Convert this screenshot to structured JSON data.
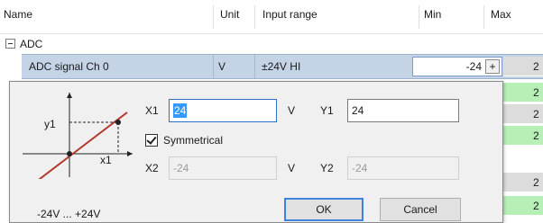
{
  "columns": {
    "name": "Name",
    "unit": "Unit",
    "input_range": "Input range",
    "min": "Min",
    "max": "Max"
  },
  "group": {
    "label": "ADC"
  },
  "selected_row": {
    "name": "ADC signal Ch 0",
    "unit": "V",
    "range": "±24V HI",
    "min": "-24",
    "spin": "+"
  },
  "max_values": [
    "2",
    "2",
    "2",
    "2",
    "2",
    "",
    "2",
    "2"
  ],
  "dialog": {
    "diagram": {
      "y_label": "y1",
      "x_label": "x1",
      "caption": "-24V ... +24V"
    },
    "x1_label": "X1",
    "x1_value": "24",
    "x1_unit": "V",
    "y1_label": "Y1",
    "y1_value": "24",
    "symmetrical_label": "Symmetrical",
    "symmetrical_checked": true,
    "x2_label": "X2",
    "x2_value": "-24",
    "x2_unit": "V",
    "y2_label": "Y2",
    "y2_value": "-24",
    "ok_label": "OK",
    "cancel_label": "Cancel"
  },
  "colors": {
    "selected_row": "#c5d3e6",
    "valid_cell": "#b6f0b6",
    "diagram_line": "#b23a2e"
  }
}
